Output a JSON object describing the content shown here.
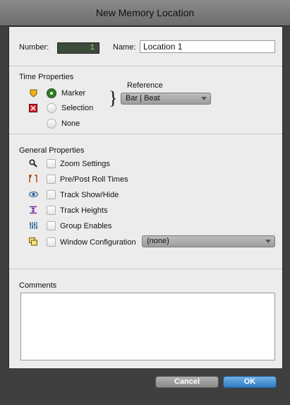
{
  "window": {
    "title": "New Memory Location"
  },
  "header": {
    "number_label": "Number:",
    "number_value": "1",
    "name_label": "Name:",
    "name_value": "Location 1"
  },
  "time_properties": {
    "heading": "Time Properties",
    "options": [
      {
        "label": "Marker",
        "selected": true,
        "icon": "marker-icon",
        "color": "#f1b21a"
      },
      {
        "label": "Selection",
        "selected": false,
        "icon": "selection-icon",
        "color": "#d21f2d"
      },
      {
        "label": "None",
        "selected": false,
        "icon": ""
      }
    ],
    "reference_label": "Reference",
    "reference_value": "Bar | Beat"
  },
  "general_properties": {
    "heading": "General Properties",
    "items": [
      {
        "label": "Zoom Settings",
        "icon": "magnifier-icon",
        "checked": false
      },
      {
        "label": "Pre/Post Roll Times",
        "icon": "pre-post-roll-icon",
        "checked": false
      },
      {
        "label": "Track Show/Hide",
        "icon": "eye-icon",
        "checked": false
      },
      {
        "label": "Track Heights",
        "icon": "track-heights-icon",
        "checked": false
      },
      {
        "label": "Group Enables",
        "icon": "group-enables-icon",
        "checked": false
      },
      {
        "label": "Window Configuration",
        "icon": "window-config-icon",
        "checked": false
      }
    ],
    "window_config_value": "(none)"
  },
  "comments": {
    "label": "Comments",
    "value": ""
  },
  "buttons": {
    "cancel": "Cancel",
    "ok": "OK"
  },
  "colors": {
    "ok_blue": "#3b86c8",
    "number_green": "#9fd36a",
    "marker_yellow": "#f1b21a",
    "selection_red": "#d21f2d"
  }
}
